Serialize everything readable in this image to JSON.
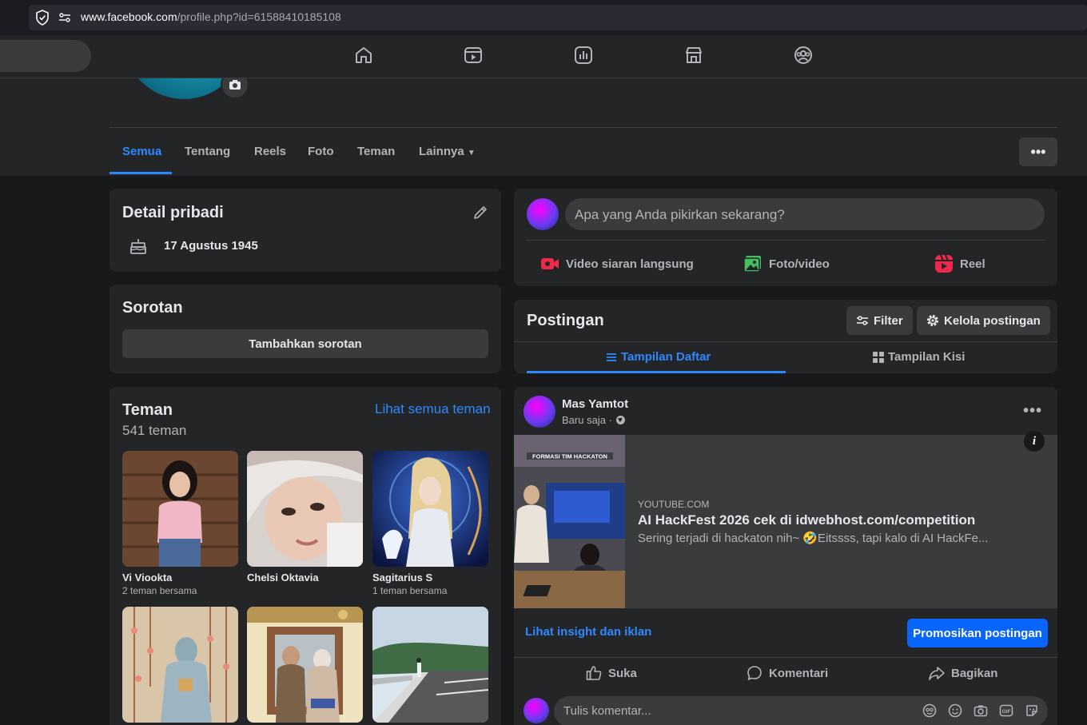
{
  "browser": {
    "url_host": "www.facebook.com",
    "url_path": "/profile.php?id=61588410185108"
  },
  "topnav": {
    "icons": [
      "home-icon",
      "video-icon",
      "dashboard-icon",
      "marketplace-icon",
      "groups-icon"
    ]
  },
  "profile_tabs": {
    "items": [
      "Semua",
      "Tentang",
      "Reels",
      "Foto",
      "Teman",
      "Lainnya"
    ],
    "active": "Semua",
    "more_label": "•••"
  },
  "personal_details": {
    "title": "Detail pribadi",
    "birthday": "17 Agustus 1945"
  },
  "highlights": {
    "title": "Sorotan",
    "button": "Tambahkan sorotan"
  },
  "friends": {
    "title": "Teman",
    "see_all": "Lihat semua teman",
    "count": "541 teman",
    "list": [
      {
        "name": "Vi Viookta",
        "mutual": "2 teman bersama"
      },
      {
        "name": "Chelsi Oktavia",
        "mutual": ""
      },
      {
        "name": "Sagitarius S",
        "mutual": "1 teman bersama"
      }
    ]
  },
  "composer": {
    "placeholder": "Apa yang Anda pikirkan sekarang?",
    "actions": {
      "live": "Video siaran langsung",
      "photo": "Foto/video",
      "reel": "Reel"
    }
  },
  "posts_header": {
    "title": "Postingan",
    "filter": "Filter",
    "manage": "Kelola postingan",
    "list_view": "Tampilan Daftar",
    "grid_view": "Tampilan Kisi"
  },
  "post": {
    "author": "Mas Yamtot",
    "time": "Baru saja ·",
    "link": {
      "domain": "YOUTUBE.COM",
      "title": "AI HackFest 2026 cek di idwebhost.com/competition",
      "description": "Sering terjadi di hackaton nih~ 🤣Eitssss, tapi kalo di AI HackFe...",
      "thumb_caption": "FORMASI TIM HACKATON"
    },
    "insight": "Lihat insight dan iklan",
    "promote": "Promosikan postingan",
    "reactions": {
      "like": "Suka",
      "comment": "Komentari",
      "share": "Bagikan"
    },
    "comment_placeholder": "Tulis komentar..."
  },
  "colors": {
    "accent": "#2d88ff",
    "promote": "#0866ff",
    "bg": "#18191a",
    "card": "#242526"
  }
}
